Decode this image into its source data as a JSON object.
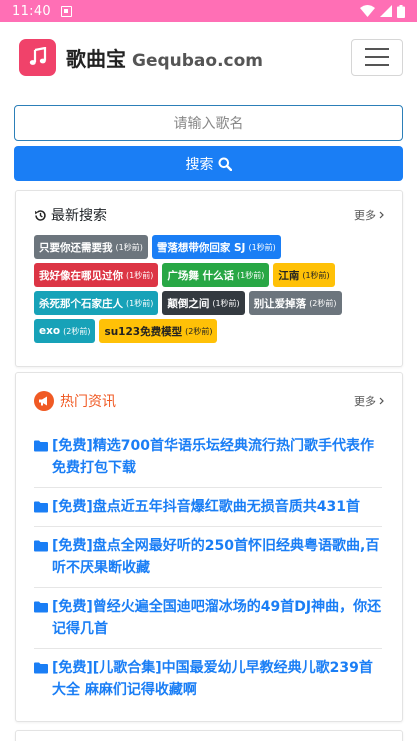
{
  "status_bar": {
    "time": "11:40"
  },
  "colors": {
    "status_bar": "#ff6fb5",
    "primary": "#1a7ef5",
    "news_accent": "#f05a24",
    "logo": "#f0426a"
  },
  "navbar": {
    "brand_name": "歌曲宝",
    "brand_domain": "Gequbao.com"
  },
  "search": {
    "placeholder": "请输入歌名",
    "button_label": "搜索"
  },
  "recent": {
    "title": "最新搜索",
    "more": "更多",
    "tags": [
      {
        "text": "只要你还需要我",
        "time": "(1秒前)",
        "color": "#6c757d"
      },
      {
        "text": "雪落想带你回家 SJ",
        "time": "(1秒前)",
        "color": "#1a7ef5"
      },
      {
        "text": "我好像在哪见过你",
        "time": "(1秒前)",
        "color": "#dc3545"
      },
      {
        "text": "广场舞 什么话",
        "time": "(1秒前)",
        "color": "#28a745"
      },
      {
        "text": "江南",
        "time": "(1秒前)",
        "color": "#ffc107"
      },
      {
        "text": "杀死那个石家庄人",
        "time": "(1秒前)",
        "color": "#17a2b8"
      },
      {
        "text": "颠倒之间",
        "time": "(1秒前)",
        "color": "#343a40"
      },
      {
        "text": "别让爱掉落",
        "time": "(2秒前)",
        "color": "#6c757d"
      },
      {
        "text": "exo",
        "time": "(2秒前)",
        "color": "#17a2b8"
      },
      {
        "text": "su123免费模型",
        "time": "(2秒前)",
        "color": "#ffc107"
      }
    ]
  },
  "news": {
    "title": "热门资讯",
    "more": "更多",
    "items": [
      "[免费]精选700首华语乐坛经典流行热门歌手代表作免费打包下载",
      "[免费]盘点近五年抖音爆红歌曲无损音质共431首",
      "[免费]盘点全网最好听的250首怀旧经典粤语歌曲,百听不厌果断收藏",
      "[免费]曾经火遍全国迪吧溜冰场的49首DJ神曲，你还记得几首",
      "[免费][儿歌合集]中国最爱幼儿早教经典儿歌239首大全 麻麻们记得收藏啊"
    ]
  }
}
